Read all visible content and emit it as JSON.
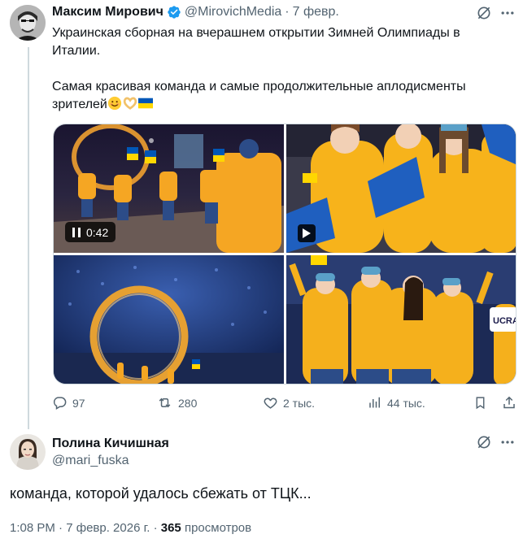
{
  "tweet": {
    "author_name": "Максим Мирович",
    "author_handle": "@MirovichMedia",
    "separator": "·",
    "date": "7 февр.",
    "text_line1": "Украинская сборная на вчерашнем открытии Зимней Олимпиады в Италии.",
    "text_line2": "Самая красивая команда и самые продолжительные аплодисменты зрителей",
    "emojis": [
      "smiling-face",
      "heart-hands",
      "ukraine-flag"
    ],
    "media": {
      "video_duration": "0:42",
      "image_sign": "UCRA"
    },
    "actions": {
      "replies": "97",
      "reposts": "280",
      "likes": "2 тыс.",
      "views": "44 тыс."
    },
    "icons": [
      "verified-badge-icon",
      "grok-icon",
      "more-icon",
      "reply-icon",
      "repost-icon",
      "like-icon",
      "views-icon",
      "bookmark-icon",
      "share-icon"
    ]
  },
  "reply": {
    "author_name": "Полина Кичишная",
    "author_handle": "@mari_fuska",
    "text": "команда, которой удалось сбежать от ТЦК...",
    "time": "1:08 PM",
    "date": "7 февр. 2026 г.",
    "separator": "·",
    "views_count": "365",
    "views_label": "просмотров"
  },
  "colors": {
    "verified": "#1d9bf0",
    "secondary_text": "#536471",
    "thread_line": "#cfd9de",
    "ukraine_blue": "#0057b7",
    "ukraine_yellow": "#ffd700"
  }
}
